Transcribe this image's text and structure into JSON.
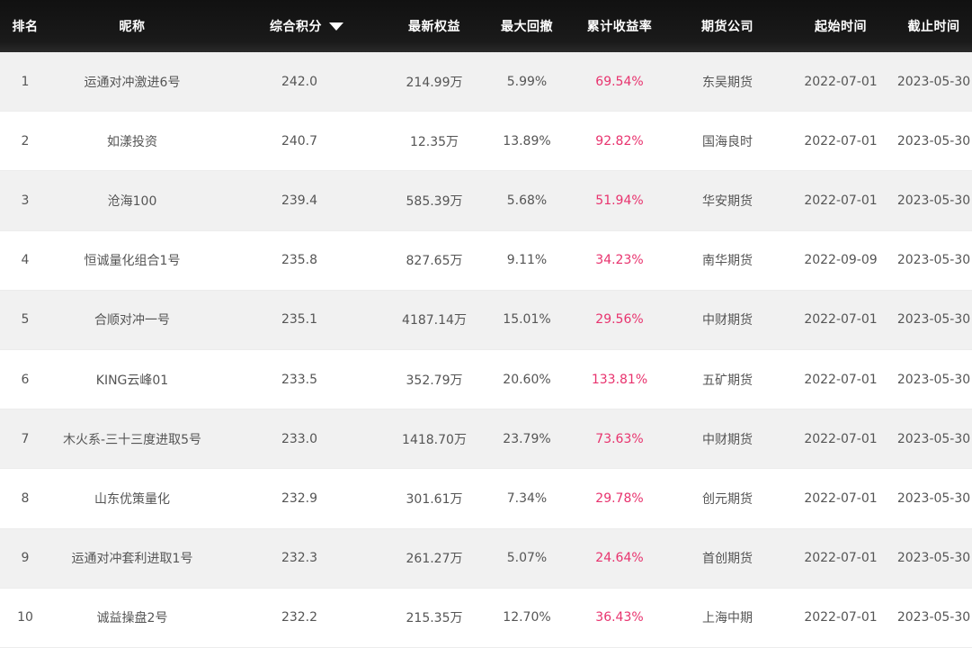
{
  "header": {
    "rank": "排名",
    "name": "昵称",
    "score": "综合积分",
    "equity": "最新权益",
    "drawdown": "最大回撤",
    "return": "累计收益率",
    "company": "期货公司",
    "start": "起始时间",
    "end": "截止时间"
  },
  "colors": {
    "header_bg": "#111111",
    "return_text": "#e8336e",
    "row_alt": "#f1f1f1"
  },
  "rows": [
    {
      "rank": "1",
      "name": "运通对冲激进6号",
      "score": "242.0",
      "equity": "214.99万",
      "drawdown": "5.99%",
      "return": "69.54%",
      "company": "东吴期货",
      "start": "2022-07-01",
      "end": "2023-05-30"
    },
    {
      "rank": "2",
      "name": "如漾投资",
      "score": "240.7",
      "equity": "12.35万",
      "drawdown": "13.89%",
      "return": "92.82%",
      "company": "国海良时",
      "start": "2022-07-01",
      "end": "2023-05-30"
    },
    {
      "rank": "3",
      "name": "沧海100",
      "score": "239.4",
      "equity": "585.39万",
      "drawdown": "5.68%",
      "return": "51.94%",
      "company": "华安期货",
      "start": "2022-07-01",
      "end": "2023-05-30"
    },
    {
      "rank": "4",
      "name": "恒诚量化组合1号",
      "score": "235.8",
      "equity": "827.65万",
      "drawdown": "9.11%",
      "return": "34.23%",
      "company": "南华期货",
      "start": "2022-09-09",
      "end": "2023-05-30"
    },
    {
      "rank": "5",
      "name": "合顺对冲一号",
      "score": "235.1",
      "equity": "4187.14万",
      "drawdown": "15.01%",
      "return": "29.56%",
      "company": "中财期货",
      "start": "2022-07-01",
      "end": "2023-05-30"
    },
    {
      "rank": "6",
      "name": "KING云峰01",
      "score": "233.5",
      "equity": "352.79万",
      "drawdown": "20.60%",
      "return": "133.81%",
      "company": "五矿期货",
      "start": "2022-07-01",
      "end": "2023-05-30"
    },
    {
      "rank": "7",
      "name": "木火系-三十三度进取5号",
      "score": "233.0",
      "equity": "1418.70万",
      "drawdown": "23.79%",
      "return": "73.63%",
      "company": "中财期货",
      "start": "2022-07-01",
      "end": "2023-05-30"
    },
    {
      "rank": "8",
      "name": "山东优策量化",
      "score": "232.9",
      "equity": "301.61万",
      "drawdown": "7.34%",
      "return": "29.78%",
      "company": "创元期货",
      "start": "2022-07-01",
      "end": "2023-05-30"
    },
    {
      "rank": "9",
      "name": "运通对冲套利进取1号",
      "score": "232.3",
      "equity": "261.27万",
      "drawdown": "5.07%",
      "return": "24.64%",
      "company": "首创期货",
      "start": "2022-07-01",
      "end": "2023-05-30"
    },
    {
      "rank": "10",
      "name": "诚益操盘2号",
      "score": "232.2",
      "equity": "215.35万",
      "drawdown": "12.70%",
      "return": "36.43%",
      "company": "上海中期",
      "start": "2022-07-01",
      "end": "2023-05-30"
    }
  ]
}
